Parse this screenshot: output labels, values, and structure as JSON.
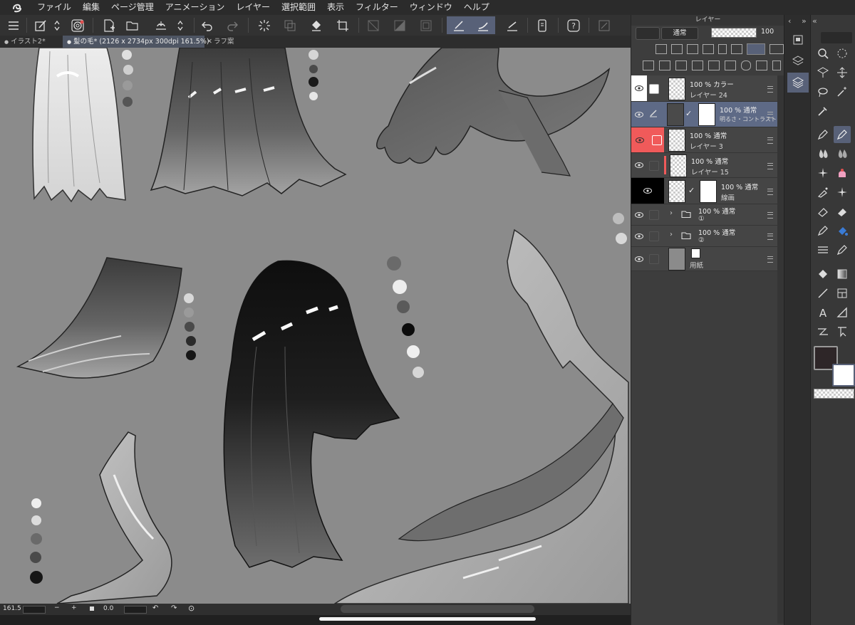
{
  "menu": [
    "ファイル",
    "編集",
    "ページ管理",
    "アニメーション",
    "レイヤー",
    "選択範囲",
    "表示",
    "フィルター",
    "ウィンドウ",
    "ヘルプ"
  ],
  "tabs": [
    {
      "label": "イラスト2*",
      "prefix": "●"
    },
    {
      "label": "髪の毛* (2126 x 2734px 300dpi 161.5%)",
      "prefix": "●"
    },
    {
      "label": "ラフ案",
      "prefix": "✕"
    }
  ],
  "status": {
    "zoom": "161.5",
    "minus": "−",
    "plus": "+",
    "angle": "0.0"
  },
  "layer_panel": {
    "title": "レイヤー",
    "blend_mode": "通常",
    "opacity": "100",
    "layers": [
      {
        "line1": "100 % カラー",
        "line2": "レイヤー 24"
      },
      {
        "line1": "100 % 通常",
        "line2": "明るさ・コントラスト"
      },
      {
        "line1": "100 % 通常",
        "line2": "レイヤー 3"
      },
      {
        "line1": "100 % 通常",
        "line2": "レイヤー 15"
      },
      {
        "line1": "100 % 通常",
        "line2": "線画"
      },
      {
        "line1": "100 % 通常",
        "line2": "①"
      },
      {
        "line1": "100 % 通常",
        "line2": "②"
      },
      {
        "line1": "",
        "line2": "用紙"
      }
    ]
  },
  "colors": {
    "accent": "#586178",
    "selected_layer": "#5e6a86",
    "red_layer": "#f05a5a",
    "main_color": "#2e2628",
    "sub_color": "#ffffff",
    "canvas": "#8b8b8b"
  },
  "icons": [
    "clip-studio-logo-icon",
    "hamburger-icon",
    "brush-settings-icon",
    "updown-icon",
    "layer-settings-icon",
    "new-canvas-icon",
    "open-icon",
    "save-cloud-icon",
    "undo-icon",
    "redo-icon",
    "spinner-icon",
    "clear-icon",
    "fill-icon",
    "crop-icon",
    "pen-draw-icon",
    "stroke-icon",
    "ruler-icon",
    "phone-icon",
    "help-icon",
    "fullscreen-icon",
    "eye-icon",
    "folder-icon",
    "magnify-icon",
    "move-icon",
    "lasso-icon",
    "eyedropper-icon",
    "pen-icon",
    "blur-icon",
    "sparkle-icon",
    "eraser-icon",
    "fill-bucket-icon",
    "gradient-icon",
    "line-icon",
    "frame-icon",
    "text-icon",
    "balloon-icon"
  ]
}
